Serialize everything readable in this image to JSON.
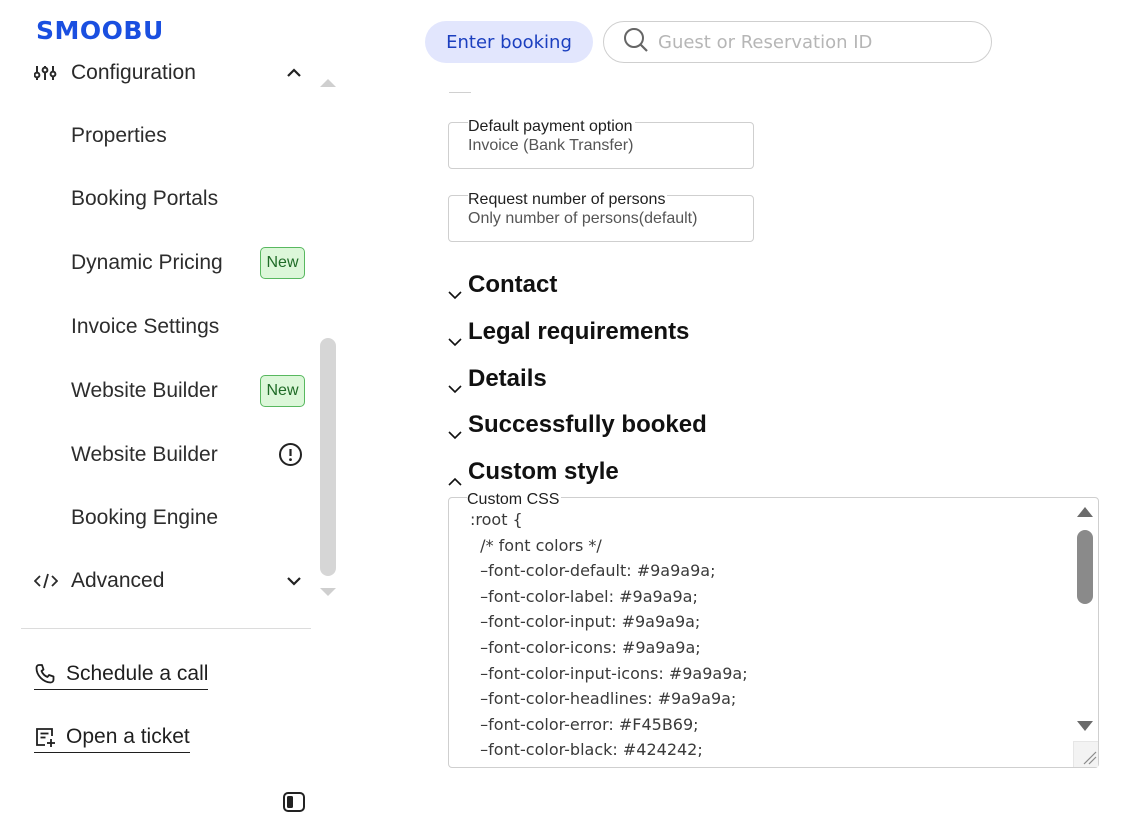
{
  "app": {
    "logo": "SMOOBU"
  },
  "sidebar": {
    "section_title": "Configuration",
    "items": [
      {
        "label": "Properties"
      },
      {
        "label": "Booking Portals"
      },
      {
        "label": "Dynamic Pricing",
        "badge": "New"
      },
      {
        "label": "Invoice Settings"
      },
      {
        "label": "Website Builder",
        "badge": "New"
      },
      {
        "label": "Website Builder",
        "icon": "alert-circle-icon"
      },
      {
        "label": "Booking Engine"
      }
    ],
    "advanced_label": "Advanced",
    "footer": {
      "schedule_call": "Schedule a call",
      "open_ticket": "Open a ticket"
    }
  },
  "topbar": {
    "enter_booking": "Enter booking",
    "search_placeholder": "Guest or Reservation ID"
  },
  "form": {
    "payment": {
      "label": "Default payment option",
      "value": "Invoice (Bank Transfer)"
    },
    "persons": {
      "label": "Request number of persons",
      "value": "Only number of persons(default)"
    }
  },
  "sections": [
    {
      "label": "Contact",
      "expanded": false
    },
    {
      "label": "Legal requirements",
      "expanded": false
    },
    {
      "label": "Details",
      "expanded": false
    },
    {
      "label": "Successfully booked",
      "expanded": false
    },
    {
      "label": "Custom style",
      "expanded": true
    }
  ],
  "custom_css": {
    "label": "Custom CSS",
    "lines": [
      ":root {",
      "  /* font colors */",
      "  –font-color-default: #9a9a9a;",
      "  –font-color-label: #9a9a9a;",
      "  –font-color-input: #9a9a9a;",
      "  –font-color-icons: #9a9a9a;",
      "  –font-color-input-icons: #9a9a9a;",
      "  –font-color-headlines: #9a9a9a;",
      "  –font-color-error: #F45B69;",
      "  –font-color-black: #424242;"
    ]
  },
  "colors": {
    "brand": "#1a4fe0",
    "badge_bg": "#dcf7d9",
    "button_bg": "#e2e6fd"
  }
}
